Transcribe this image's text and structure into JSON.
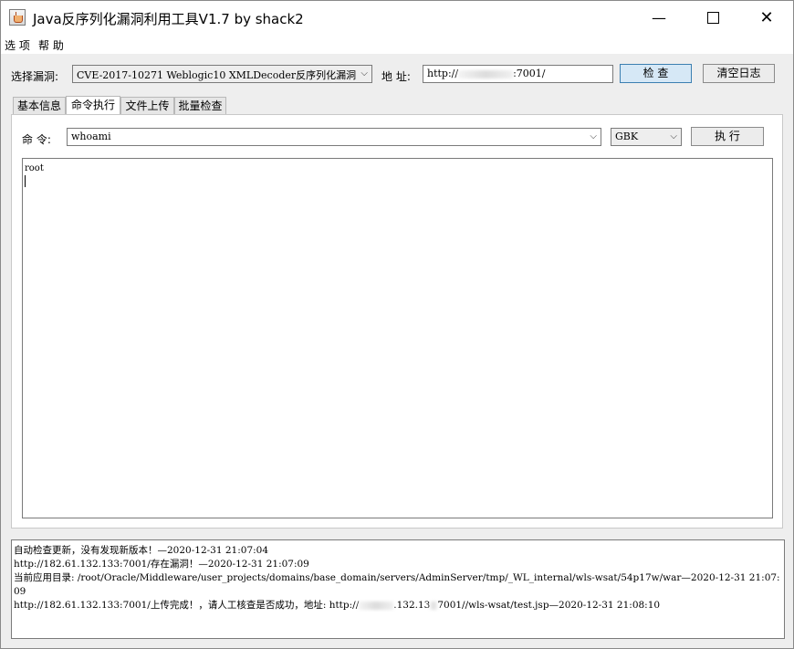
{
  "window": {
    "title": "Java反序列化漏洞利用工具V1.7 by shack2"
  },
  "menubar": {
    "items": [
      "选 项",
      "帮 助"
    ]
  },
  "toolbar": {
    "vuln_label": "选择漏洞:",
    "vuln_selected": "CVE-2017-10271 Weblogic10 XMLDecoder反序列化漏洞",
    "address_label": "地 址:",
    "address_prefix": "http://",
    "address_suffix": ":7001/",
    "check_button": "检 查",
    "clear_log_button": "清空日志"
  },
  "tabs": [
    {
      "label": "基本信息",
      "active": false
    },
    {
      "label": "命令执行",
      "active": true
    },
    {
      "label": "文件上传",
      "active": false
    },
    {
      "label": "批量检查",
      "active": false
    }
  ],
  "command_panel": {
    "command_label": "命 令:",
    "command_value": "whoami",
    "encoding_selected": "GBK",
    "execute_button": "执 行",
    "output_text": "root"
  },
  "log": {
    "lines": [
      "自动检查更新，没有发现新版本！—2020-12-31 21:07:04",
      "http://182.61.132.133:7001/存在漏洞！—2020-12-31 21:07:09",
      "当前应用目录: /root/Oracle/Middleware/user_projects/domains/base_domain/servers/AdminServer/tmp/_WL_internal/wls-wsat/54p17w/war—2020-12-31 21:07:09"
    ],
    "last_line_prefix": "http://182.61.132.133:7001/上传完成！，请人工核查是否成功，地址: http://",
    "last_line_middle": ".132.13",
    "last_line_suffix": "7001//wls-wsat/test.jsp—2020-12-31 21:08:10"
  },
  "icons": {
    "app": "java-coffee-cup-icon",
    "minimize": "minimize-icon",
    "maximize": "maximize-icon",
    "close": "close-icon",
    "dropdown": "chevron-down-icon"
  }
}
